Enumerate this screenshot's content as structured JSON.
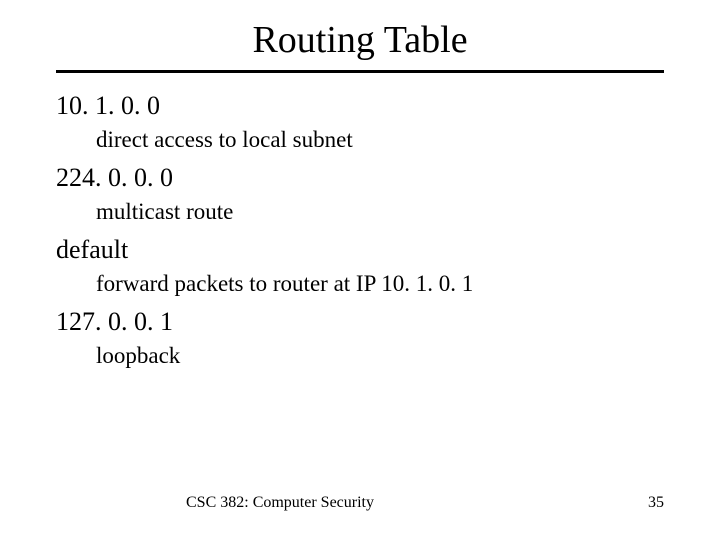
{
  "title": "Routing Table",
  "entries": [
    {
      "address": "10. 1. 0. 0",
      "desc": "direct access to local subnet"
    },
    {
      "address": "224. 0. 0. 0",
      "desc": "multicast route"
    },
    {
      "address": "default",
      "desc": "forward packets to router at IP 10. 1. 0. 1"
    },
    {
      "address": "127. 0. 0. 1",
      "desc": "loopback"
    }
  ],
  "footer": {
    "course": "CSC 382: Computer Security",
    "page": "35"
  }
}
